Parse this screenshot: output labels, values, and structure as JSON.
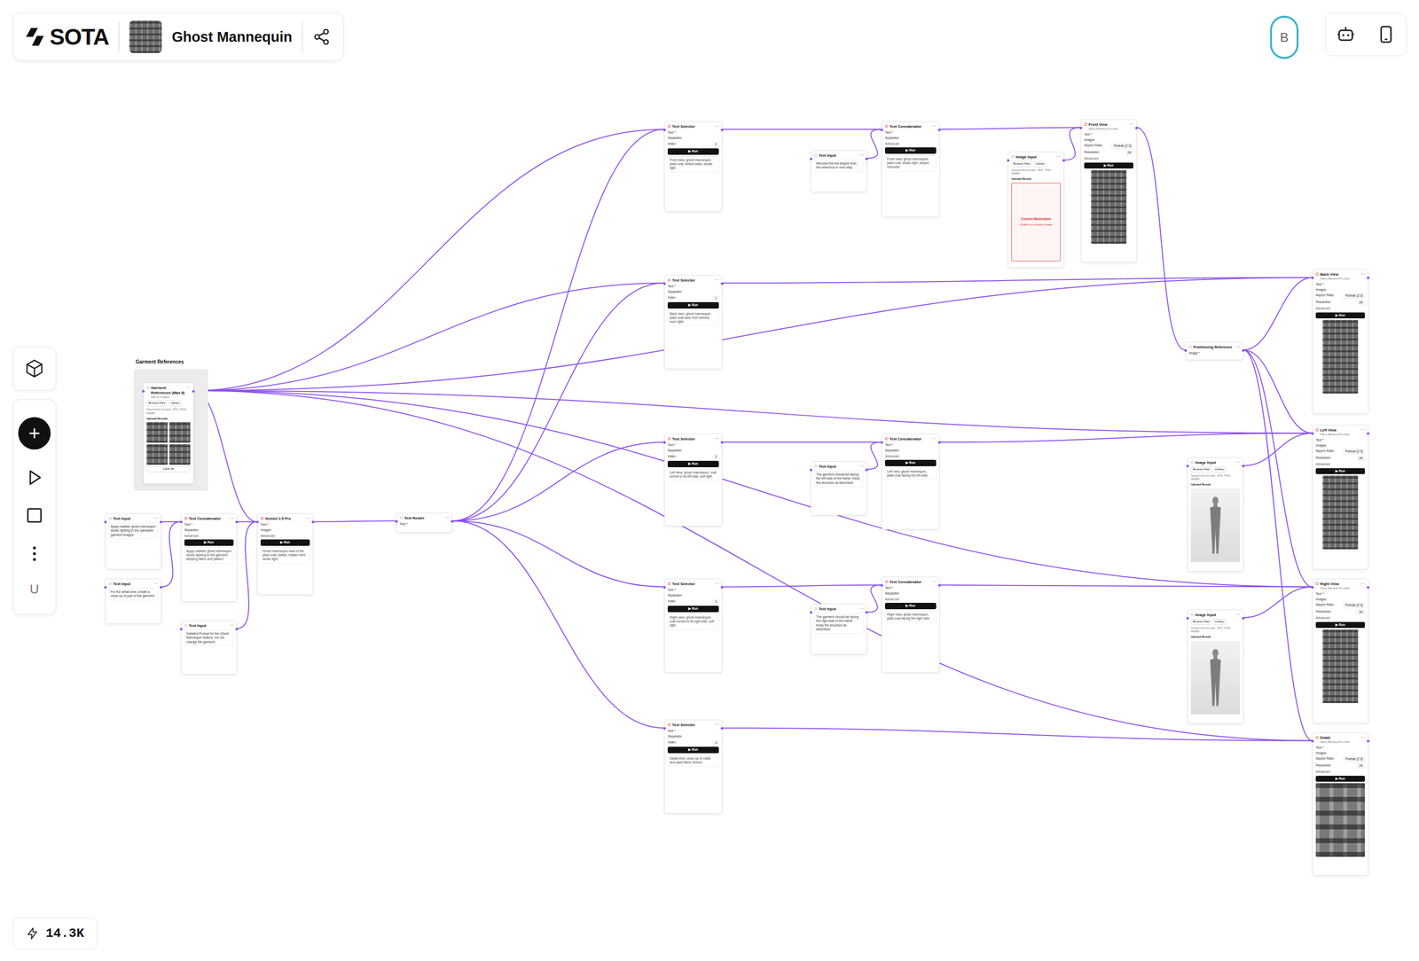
{
  "app": {
    "brand": "SOTA",
    "project": "Ghost Mannequin",
    "avatar": "B",
    "user": "U",
    "credits": "14.3K"
  },
  "group": {
    "label": "Garment References"
  },
  "nodes": [
    {
      "kind": "gallery",
      "title": "Garment References (Max 8)",
      "subtitle": "Max 8 Images",
      "buttons": [
        "Browse Files",
        "Library"
      ],
      "note": "Supported formats: JPG, PNG, WEBP",
      "result": "Upload Results",
      "image_count": 4,
      "action": "Clear All"
    },
    {
      "kind": "text",
      "title": "Text Input",
      "body": "Apply realistic ghost mannequin studio lighting to the uploaded garment images."
    },
    {
      "kind": "text",
      "title": "Text Input",
      "body": "For the detail shot, create a close-up of part of the garment."
    },
    {
      "kind": "tool",
      "title": "Text Concatenator",
      "fields": [
        {
          "label": "Text *",
          "value": ""
        },
        {
          "label": "Separator",
          "value": ""
        }
      ],
      "extra": "Advanced",
      "button": "▶ Run",
      "preview": "Apply realistic ghost mannequin studio lighting to the garment, keeping fabric and pattern."
    },
    {
      "kind": "text",
      "title": "Text Input",
      "body": "Detailed Prompt for the Ghost Mannequin feature. Do not change the garment."
    },
    {
      "kind": "tool",
      "title": "Gemini 2.5 Pro",
      "fields": [
        {
          "label": "Text *",
          "value": ""
        },
        {
          "label": "Images",
          "value": ""
        }
      ],
      "extra": "Advanced",
      "button": "▶ Run",
      "preview": "Ghost mannequin view of the plaid coat, belted, hidden form, studio light."
    },
    {
      "kind": "router",
      "title": "Text Router",
      "fields": [
        {
          "label": "Text *",
          "value": ""
        }
      ]
    },
    {
      "kind": "tool",
      "title": "Text Selector",
      "fields": [
        {
          "label": "Text *",
          "value": ""
        },
        {
          "label": "Separator",
          "value": ""
        },
        {
          "label": "Index",
          "value": "0"
        }
      ],
      "button": "▶ Run",
      "preview": "Front view: ghost mannequin, plaid coat, belted waist, studio light."
    },
    {
      "kind": "tool",
      "title": "Text Selector",
      "fields": [
        {
          "label": "Text *",
          "value": ""
        },
        {
          "label": "Separator",
          "value": ""
        },
        {
          "label": "Index",
          "value": "1"
        }
      ],
      "button": "▶ Run",
      "preview": "Back view: ghost mannequin, plaid coat seen from behind, even light."
    },
    {
      "kind": "tool",
      "title": "Text Selector",
      "fields": [
        {
          "label": "Text *",
          "value": ""
        },
        {
          "label": "Separator",
          "value": ""
        },
        {
          "label": "Index",
          "value": "2"
        }
      ],
      "button": "▶ Run",
      "preview": "Left view: ghost mannequin, coat turned to its left side, soft light."
    },
    {
      "kind": "tool",
      "title": "Text Selector",
      "fields": [
        {
          "label": "Text *",
          "value": ""
        },
        {
          "label": "Separator",
          "value": ""
        },
        {
          "label": "Index",
          "value": "3"
        }
      ],
      "button": "▶ Run",
      "preview": "Right view: ghost mannequin, coat turned to its right side, soft light."
    },
    {
      "kind": "tool",
      "title": "Text Selector",
      "fields": [
        {
          "label": "Text *",
          "value": ""
        },
        {
          "label": "Separator",
          "value": ""
        },
        {
          "label": "Index",
          "value": "4"
        }
      ],
      "button": "▶ Run",
      "preview": "Detail shot: close-up of collar and plaid fabric texture."
    },
    {
      "kind": "text",
      "title": "Text Input",
      "body": "Remove the red stripes from the reference in next step."
    },
    {
      "kind": "text",
      "title": "Text Input",
      "body": "The garment should be facing the left side of the frame. Keep the structure as described."
    },
    {
      "kind": "text",
      "title": "Text Input",
      "body": "The garment should be facing the right side of the frame. Keep the structure as described."
    },
    {
      "kind": "tool",
      "title": "Text Concatenator",
      "fields": [
        {
          "label": "Text *",
          "value": ""
        },
        {
          "label": "Separator",
          "value": ""
        }
      ],
      "extra": "Advanced",
      "button": "▶ Run",
      "preview": "Front view, ghost mannequin, plaid coat, studio light, stripes removed."
    },
    {
      "kind": "tool",
      "title": "Text Concatenator",
      "fields": [
        {
          "label": "Text *",
          "value": ""
        },
        {
          "label": "Separator",
          "value": ""
        }
      ],
      "extra": "Advanced",
      "button": "▶ Run",
      "preview": "Left view, ghost mannequin, plaid coat facing the left side."
    },
    {
      "kind": "tool",
      "title": "Text Concatenator",
      "fields": [
        {
          "label": "Text *",
          "value": ""
        },
        {
          "label": "Separator",
          "value": ""
        }
      ],
      "extra": "Advanced",
      "button": "▶ Run",
      "preview": "Right view, ghost mannequin, plaid coat facing the right side."
    },
    {
      "kind": "image",
      "title": "Image Input",
      "buttons": [
        "Browse Files",
        "Library"
      ],
      "note": "Supported formats: JPG, PNG, WEBP",
      "result": "Upload Result",
      "picture": "alert",
      "alert": "Content Moderation",
      "alert_note": "Unable to process image"
    },
    {
      "kind": "output",
      "title": "Front View",
      "subtitle": "Nano Banana Pro Edit",
      "fields": [
        {
          "label": "Text *",
          "value": ""
        },
        {
          "label": "Images",
          "value": ""
        },
        {
          "label": "Aspect Ratio",
          "value": "Portrait (2:3)"
        },
        {
          "label": "Resolution",
          "value": "2K"
        }
      ],
      "extra": "Advanced",
      "button": "▶ Run",
      "picture": "coat"
    },
    {
      "kind": "router",
      "title": "Positioning Reference",
      "fields": [
        {
          "label": "Image *",
          "value": ""
        }
      ]
    },
    {
      "kind": "image",
      "title": "Image Input",
      "buttons": [
        "Browse Files",
        "Library"
      ],
      "note": "Supported formats: JPG, PNG, WEBP",
      "result": "Upload Result",
      "picture": "mannequin"
    },
    {
      "kind": "image",
      "title": "Image Input",
      "buttons": [
        "Browse Files",
        "Library"
      ],
      "note": "Supported formats: JPG, PNG, WEBP",
      "result": "Upload Result",
      "picture": "mannequin"
    },
    {
      "kind": "output",
      "title": "Back View",
      "subtitle": "Nano Banana Pro Edit",
      "fields": [
        {
          "label": "Text *",
          "value": ""
        },
        {
          "label": "Images",
          "value": ""
        },
        {
          "label": "Aspect Ratio",
          "value": "Portrait (2:3)"
        },
        {
          "label": "Resolution",
          "value": "2K"
        }
      ],
      "extra": "Advanced",
      "button": "▶ Run",
      "picture": "coat"
    },
    {
      "kind": "output",
      "title": "Left View",
      "subtitle": "Nano Banana Pro Edit",
      "fields": [
        {
          "label": "Text *",
          "value": ""
        },
        {
          "label": "Images",
          "value": ""
        },
        {
          "label": "Aspect Ratio",
          "value": "Portrait (2:3)"
        },
        {
          "label": "Resolution",
          "value": "2K"
        }
      ],
      "extra": "Advanced",
      "button": "▶ Run",
      "picture": "coat"
    },
    {
      "kind": "output",
      "title": "Right View",
      "subtitle": "Nano Banana Pro Edit",
      "fields": [
        {
          "label": "Text *",
          "value": ""
        },
        {
          "label": "Images",
          "value": ""
        },
        {
          "label": "Aspect Ratio",
          "value": "Portrait (2:3)"
        },
        {
          "label": "Resolution",
          "value": "2K"
        }
      ],
      "extra": "Advanced",
      "button": "▶ Run",
      "picture": "coat"
    },
    {
      "kind": "output",
      "title": "Detail",
      "subtitle": "Nano Banana Pro Edit",
      "fields": [
        {
          "label": "Text *",
          "value": ""
        },
        {
          "label": "Images",
          "value": ""
        },
        {
          "label": "Aspect Ratio",
          "value": "Portrait (2:3)"
        },
        {
          "label": "Resolution",
          "value": "2K"
        }
      ],
      "extra": "Advanced",
      "button": "▶ Run",
      "picture": "closeup"
    }
  ]
}
